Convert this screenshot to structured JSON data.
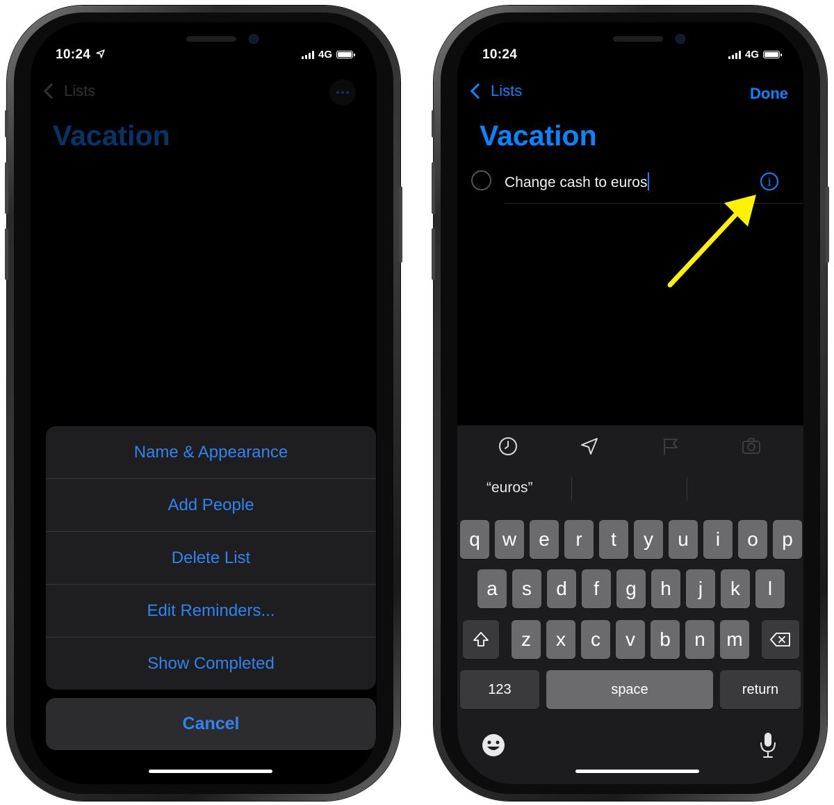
{
  "colors": {
    "accent": "#0a84ff",
    "action_sheet_text": "#2f84f2",
    "annotation_arrow": "#fff200",
    "background": "#000000"
  },
  "left_phone": {
    "status": {
      "time": "10:24",
      "network": "4G",
      "location_icon": "location-arrow-icon"
    },
    "nav": {
      "back_label": "Lists",
      "more_icon": "ellipsis-icon"
    },
    "list_title": "Vacation",
    "action_sheet": {
      "items": [
        "Name & Appearance",
        "Add People",
        "Delete List",
        "Edit Reminders...",
        "Show Completed"
      ],
      "cancel_label": "Cancel"
    }
  },
  "right_phone": {
    "status": {
      "time": "10:24",
      "network": "4G"
    },
    "nav": {
      "back_label": "Lists",
      "done_label": "Done"
    },
    "list_title": "Vacation",
    "reminder": {
      "text": "Change cash to euros",
      "info_icon": "info-icon"
    },
    "toolbar_icons": [
      "clock-icon",
      "location-icon",
      "flag-icon",
      "camera-icon"
    ],
    "suggestion": "“euros”",
    "keyboard": {
      "row1": [
        "q",
        "w",
        "e",
        "r",
        "t",
        "y",
        "u",
        "i",
        "o",
        "p"
      ],
      "row2": [
        "a",
        "s",
        "d",
        "f",
        "g",
        "h",
        "j",
        "k",
        "l"
      ],
      "row3": [
        "z",
        "x",
        "c",
        "v",
        "b",
        "n",
        "m"
      ],
      "numbers_label": "123",
      "space_label": "space",
      "return_label": "return",
      "emoji_icon": "emoji-icon",
      "mic_icon": "microphone-icon"
    }
  }
}
